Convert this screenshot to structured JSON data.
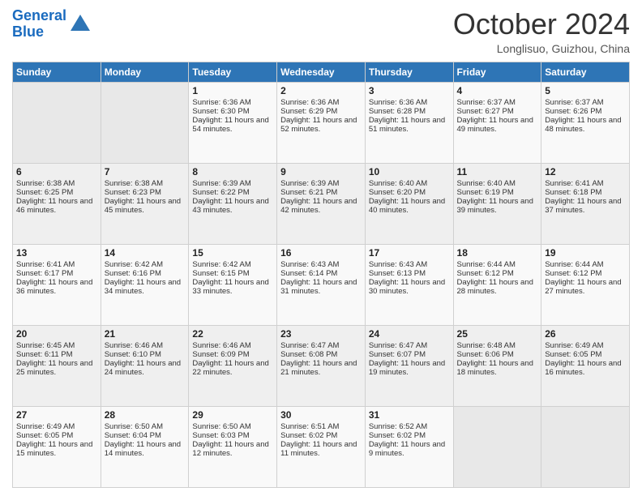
{
  "header": {
    "logo_line1": "General",
    "logo_line2": "Blue",
    "month_title": "October 2024",
    "location": "Longlisuo, Guizhou, China"
  },
  "weekdays": [
    "Sunday",
    "Monday",
    "Tuesday",
    "Wednesday",
    "Thursday",
    "Friday",
    "Saturday"
  ],
  "weeks": [
    [
      {
        "day": "",
        "sunrise": "",
        "sunset": "",
        "daylight": ""
      },
      {
        "day": "",
        "sunrise": "",
        "sunset": "",
        "daylight": ""
      },
      {
        "day": "1",
        "sunrise": "Sunrise: 6:36 AM",
        "sunset": "Sunset: 6:30 PM",
        "daylight": "Daylight: 11 hours and 54 minutes."
      },
      {
        "day": "2",
        "sunrise": "Sunrise: 6:36 AM",
        "sunset": "Sunset: 6:29 PM",
        "daylight": "Daylight: 11 hours and 52 minutes."
      },
      {
        "day": "3",
        "sunrise": "Sunrise: 6:36 AM",
        "sunset": "Sunset: 6:28 PM",
        "daylight": "Daylight: 11 hours and 51 minutes."
      },
      {
        "day": "4",
        "sunrise": "Sunrise: 6:37 AM",
        "sunset": "Sunset: 6:27 PM",
        "daylight": "Daylight: 11 hours and 49 minutes."
      },
      {
        "day": "5",
        "sunrise": "Sunrise: 6:37 AM",
        "sunset": "Sunset: 6:26 PM",
        "daylight": "Daylight: 11 hours and 48 minutes."
      }
    ],
    [
      {
        "day": "6",
        "sunrise": "Sunrise: 6:38 AM",
        "sunset": "Sunset: 6:25 PM",
        "daylight": "Daylight: 11 hours and 46 minutes."
      },
      {
        "day": "7",
        "sunrise": "Sunrise: 6:38 AM",
        "sunset": "Sunset: 6:23 PM",
        "daylight": "Daylight: 11 hours and 45 minutes."
      },
      {
        "day": "8",
        "sunrise": "Sunrise: 6:39 AM",
        "sunset": "Sunset: 6:22 PM",
        "daylight": "Daylight: 11 hours and 43 minutes."
      },
      {
        "day": "9",
        "sunrise": "Sunrise: 6:39 AM",
        "sunset": "Sunset: 6:21 PM",
        "daylight": "Daylight: 11 hours and 42 minutes."
      },
      {
        "day": "10",
        "sunrise": "Sunrise: 6:40 AM",
        "sunset": "Sunset: 6:20 PM",
        "daylight": "Daylight: 11 hours and 40 minutes."
      },
      {
        "day": "11",
        "sunrise": "Sunrise: 6:40 AM",
        "sunset": "Sunset: 6:19 PM",
        "daylight": "Daylight: 11 hours and 39 minutes."
      },
      {
        "day": "12",
        "sunrise": "Sunrise: 6:41 AM",
        "sunset": "Sunset: 6:18 PM",
        "daylight": "Daylight: 11 hours and 37 minutes."
      }
    ],
    [
      {
        "day": "13",
        "sunrise": "Sunrise: 6:41 AM",
        "sunset": "Sunset: 6:17 PM",
        "daylight": "Daylight: 11 hours and 36 minutes."
      },
      {
        "day": "14",
        "sunrise": "Sunrise: 6:42 AM",
        "sunset": "Sunset: 6:16 PM",
        "daylight": "Daylight: 11 hours and 34 minutes."
      },
      {
        "day": "15",
        "sunrise": "Sunrise: 6:42 AM",
        "sunset": "Sunset: 6:15 PM",
        "daylight": "Daylight: 11 hours and 33 minutes."
      },
      {
        "day": "16",
        "sunrise": "Sunrise: 6:43 AM",
        "sunset": "Sunset: 6:14 PM",
        "daylight": "Daylight: 11 hours and 31 minutes."
      },
      {
        "day": "17",
        "sunrise": "Sunrise: 6:43 AM",
        "sunset": "Sunset: 6:13 PM",
        "daylight": "Daylight: 11 hours and 30 minutes."
      },
      {
        "day": "18",
        "sunrise": "Sunrise: 6:44 AM",
        "sunset": "Sunset: 6:12 PM",
        "daylight": "Daylight: 11 hours and 28 minutes."
      },
      {
        "day": "19",
        "sunrise": "Sunrise: 6:44 AM",
        "sunset": "Sunset: 6:12 PM",
        "daylight": "Daylight: 11 hours and 27 minutes."
      }
    ],
    [
      {
        "day": "20",
        "sunrise": "Sunrise: 6:45 AM",
        "sunset": "Sunset: 6:11 PM",
        "daylight": "Daylight: 11 hours and 25 minutes."
      },
      {
        "day": "21",
        "sunrise": "Sunrise: 6:46 AM",
        "sunset": "Sunset: 6:10 PM",
        "daylight": "Daylight: 11 hours and 24 minutes."
      },
      {
        "day": "22",
        "sunrise": "Sunrise: 6:46 AM",
        "sunset": "Sunset: 6:09 PM",
        "daylight": "Daylight: 11 hours and 22 minutes."
      },
      {
        "day": "23",
        "sunrise": "Sunrise: 6:47 AM",
        "sunset": "Sunset: 6:08 PM",
        "daylight": "Daylight: 11 hours and 21 minutes."
      },
      {
        "day": "24",
        "sunrise": "Sunrise: 6:47 AM",
        "sunset": "Sunset: 6:07 PM",
        "daylight": "Daylight: 11 hours and 19 minutes."
      },
      {
        "day": "25",
        "sunrise": "Sunrise: 6:48 AM",
        "sunset": "Sunset: 6:06 PM",
        "daylight": "Daylight: 11 hours and 18 minutes."
      },
      {
        "day": "26",
        "sunrise": "Sunrise: 6:49 AM",
        "sunset": "Sunset: 6:05 PM",
        "daylight": "Daylight: 11 hours and 16 minutes."
      }
    ],
    [
      {
        "day": "27",
        "sunrise": "Sunrise: 6:49 AM",
        "sunset": "Sunset: 6:05 PM",
        "daylight": "Daylight: 11 hours and 15 minutes."
      },
      {
        "day": "28",
        "sunrise": "Sunrise: 6:50 AM",
        "sunset": "Sunset: 6:04 PM",
        "daylight": "Daylight: 11 hours and 14 minutes."
      },
      {
        "day": "29",
        "sunrise": "Sunrise: 6:50 AM",
        "sunset": "Sunset: 6:03 PM",
        "daylight": "Daylight: 11 hours and 12 minutes."
      },
      {
        "day": "30",
        "sunrise": "Sunrise: 6:51 AM",
        "sunset": "Sunset: 6:02 PM",
        "daylight": "Daylight: 11 hours and 11 minutes."
      },
      {
        "day": "31",
        "sunrise": "Sunrise: 6:52 AM",
        "sunset": "Sunset: 6:02 PM",
        "daylight": "Daylight: 11 hours and 9 minutes."
      },
      {
        "day": "",
        "sunrise": "",
        "sunset": "",
        "daylight": ""
      },
      {
        "day": "",
        "sunrise": "",
        "sunset": "",
        "daylight": ""
      }
    ]
  ]
}
